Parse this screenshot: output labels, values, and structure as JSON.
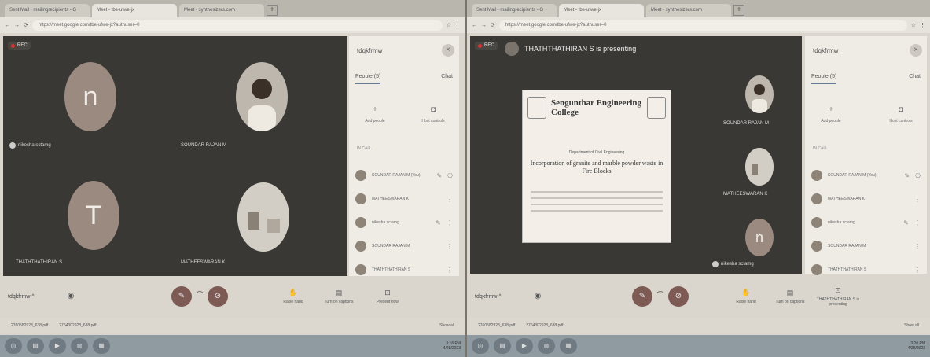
{
  "left": {
    "tabs": [
      "Sent Mail - mailingrecipients - G",
      "Meet - tbe-ufwe-jx",
      "Meet - synthesizers.com"
    ],
    "url": "https://meet.google.com/tbe-ufwe-jx?authuser=0",
    "rec_label": "REC",
    "tiles": [
      {
        "initial": "n",
        "name": "nikesha sctamg"
      },
      {
        "name": "SOUNDAR RAJAN M"
      },
      {
        "initial": "T",
        "name": "THATHTHATHIRAN S"
      },
      {
        "name": "MATHEESWARAN K"
      }
    ],
    "side": {
      "title": "tdqkfrmw",
      "tab_people": "People (5)",
      "tab_chat": "Chat",
      "add_people": "Add people",
      "host_controls": "Host controls",
      "in_call": "IN CALL",
      "people": [
        "SOUNDAR RAJAN M (You)",
        "MATHEESWARAN K",
        "nikesha sctamg",
        "SOUNDAR RAJAN M",
        "THATHTHATHIRAN S"
      ]
    },
    "meeting_code": "tdqkfrmw",
    "raise_hand": "Raise hand",
    "captions": "Turn on captions",
    "present_now": "Present now",
    "downloads": [
      "2760582928_638.pdf",
      "2764302928_638.pdf"
    ],
    "show_all": "Show all",
    "time": "3:16 PM",
    "date": "4/28/2023"
  },
  "right": {
    "tabs": [
      "Sent Mail - mailingrecipients - G",
      "Meet - tbe-ufwe-jx",
      "Meet - synthesizers.com"
    ],
    "url": "https://meet.google.com/tbe-ufwe-jx?authuser=0",
    "rec_label": "REC",
    "presenting": "THATHTHATHIRAN S is presenting",
    "slide": {
      "college": "Sengunthar Engineering College",
      "dept": "Department of Civil Engineering",
      "title": "Incorporation of granite and marble powder waste in Fire Blocks"
    },
    "tiles": [
      {
        "name": "SOUNDAR RAJAN M"
      },
      {
        "name": "MATHEESWARAN K"
      },
      {
        "initial": "n",
        "name": "nikesha sctamg"
      }
    ],
    "side": {
      "title": "tdqkfrmw",
      "tab_people": "People (5)",
      "tab_chat": "Chat",
      "add_people": "Add people",
      "host_controls": "Host controls",
      "in_call": "IN CALL",
      "people": [
        "SOUNDAR RAJAN M (You)",
        "MATHEESWARAN K",
        "nikesha sctamg",
        "SOUNDAR RAJAN M",
        "THATHTHATHIRAN S"
      ]
    },
    "meeting_code": "tdqkfrmw",
    "raise_hand": "Raise hand",
    "captions": "Turn on captions",
    "presenting_ctl": "THATHTHATHIRAN S is presenting",
    "downloads": [
      "2760582928_638.pdf",
      "2764302928_638.pdf"
    ],
    "show_all": "Show all",
    "time": "3:20 PM",
    "date": "4/28/2023"
  }
}
